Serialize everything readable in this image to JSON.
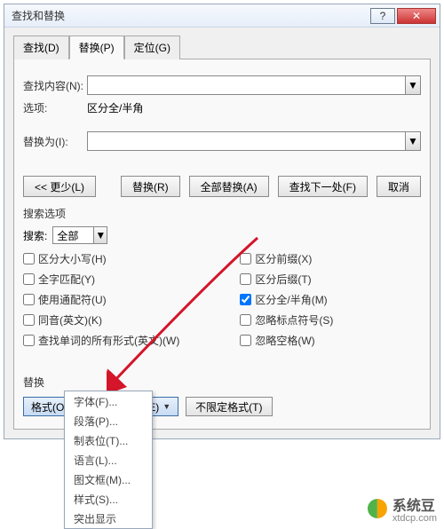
{
  "title": "查找和替换",
  "tabs": {
    "find": "查找(D)",
    "replace": "替换(P)",
    "goto": "定位(G)"
  },
  "fields": {
    "findLabel": "查找内容(N):",
    "findValue": "",
    "optionsLabel": "选项:",
    "optionsValue": "区分全/半角",
    "replaceLabel": "替换为(I):",
    "replaceValue": ""
  },
  "buttons": {
    "less": "<< 更少(L)",
    "replace": "替换(R)",
    "replaceAll": "全部替换(A)",
    "findNext": "查找下一处(F)",
    "cancel": "取消"
  },
  "searchOptions": {
    "caption": "搜索选项",
    "searchLabel": "搜索:",
    "searchValue": "全部",
    "left": [
      {
        "label": "区分大小写(H)",
        "checked": false
      },
      {
        "label": "全字匹配(Y)",
        "checked": false
      },
      {
        "label": "使用通配符(U)",
        "checked": false
      },
      {
        "label": "同音(英文)(K)",
        "checked": false
      },
      {
        "label": "查找单词的所有形式(英文)(W)",
        "checked": false
      }
    ],
    "right": [
      {
        "label": "区分前缀(X)",
        "checked": false
      },
      {
        "label": "区分后缀(T)",
        "checked": false
      },
      {
        "label": "区分全/半角(M)",
        "checked": true
      },
      {
        "label": "忽略标点符号(S)",
        "checked": false
      },
      {
        "label": "忽略空格(W)",
        "checked": false
      }
    ]
  },
  "replaceSection": {
    "caption": "替换",
    "format": "格式(O)",
    "special": "特殊格式(E)",
    "noformat": "不限定格式(T)"
  },
  "menu": {
    "items": [
      "字体(F)...",
      "段落(P)...",
      "制表位(T)...",
      "语言(L)...",
      "图文框(M)...",
      "样式(S)...",
      "突出显示"
    ]
  },
  "watermark": {
    "brand": "系统豆",
    "domain": "xtdcp.com"
  }
}
